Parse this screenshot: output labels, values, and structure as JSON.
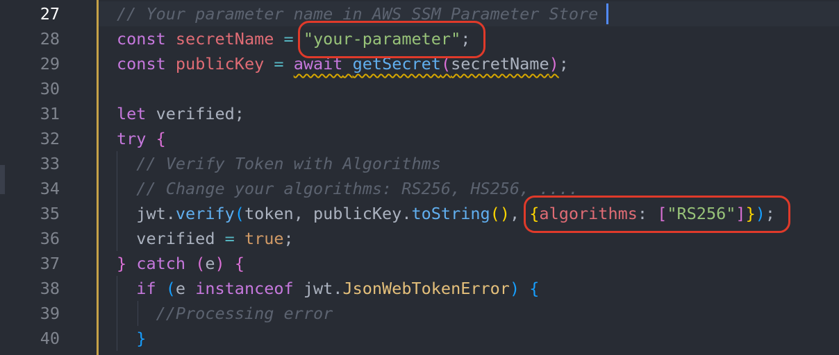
{
  "editor": {
    "current_line": 27,
    "lines": [
      {
        "number": "27",
        "tokens": [
          {
            "t": "// Your parameter name in AWS SSM Parameter Store",
            "c": "cmt"
          }
        ]
      },
      {
        "number": "28",
        "tokens": [
          {
            "t": "const",
            "c": "kw"
          },
          {
            "t": " ",
            "c": "plain"
          },
          {
            "t": "secretName",
            "c": "var"
          },
          {
            "t": " ",
            "c": "plain"
          },
          {
            "t": "=",
            "c": "op"
          },
          {
            "t": " ",
            "c": "plain"
          },
          {
            "t": "\"your-parameter\"",
            "c": "str"
          },
          {
            "t": ";",
            "c": "plain"
          }
        ]
      },
      {
        "number": "29",
        "tokens": [
          {
            "t": "const",
            "c": "kw"
          },
          {
            "t": " ",
            "c": "plain"
          },
          {
            "t": "publicKey",
            "c": "var"
          },
          {
            "t": " ",
            "c": "plain"
          },
          {
            "t": "=",
            "c": "op"
          },
          {
            "t": " ",
            "c": "plain"
          },
          {
            "t": "await",
            "c": "kw squiggle"
          },
          {
            "t": " ",
            "c": "plain squiggle"
          },
          {
            "t": "getSecret",
            "c": "fn squiggle"
          },
          {
            "t": "(",
            "c": "b2 squiggle"
          },
          {
            "t": "secretName",
            "c": "plain squiggle"
          },
          {
            "t": ")",
            "c": "b2 squiggle"
          },
          {
            "t": ";",
            "c": "plain"
          }
        ]
      },
      {
        "number": "30",
        "tokens": []
      },
      {
        "number": "31",
        "tokens": [
          {
            "t": "let",
            "c": "kw"
          },
          {
            "t": " verified;",
            "c": "plain"
          }
        ]
      },
      {
        "number": "32",
        "tokens": [
          {
            "t": "try",
            "c": "kw-ctrl"
          },
          {
            "t": " ",
            "c": "plain"
          },
          {
            "t": "{",
            "c": "b2"
          }
        ]
      },
      {
        "number": "33",
        "tokens": [
          {
            "t": "  ",
            "c": "plain"
          },
          {
            "t": "// Verify Token with Algorithms",
            "c": "cmt"
          }
        ]
      },
      {
        "number": "34",
        "tokens": [
          {
            "t": "  ",
            "c": "plain"
          },
          {
            "t": "// Change your algorithms: RS256, HS256, ....",
            "c": "cmt"
          }
        ]
      },
      {
        "number": "35",
        "tokens": [
          {
            "t": "  ",
            "c": "plain"
          },
          {
            "t": "jwt",
            "c": "plain"
          },
          {
            "t": ".",
            "c": "plain"
          },
          {
            "t": "verify",
            "c": "fn"
          },
          {
            "t": "(",
            "c": "b3"
          },
          {
            "t": "token, publicKey",
            "c": "plain"
          },
          {
            "t": ".",
            "c": "plain"
          },
          {
            "t": "toString",
            "c": "fn"
          },
          {
            "t": "()",
            "c": "b1"
          },
          {
            "t": ", ",
            "c": "plain"
          },
          {
            "t": "{",
            "c": "b1"
          },
          {
            "t": "algorithms",
            "c": "prop"
          },
          {
            "t": ": ",
            "c": "plain"
          },
          {
            "t": "[",
            "c": "b2"
          },
          {
            "t": "\"RS256\"",
            "c": "str"
          },
          {
            "t": "]",
            "c": "b2"
          },
          {
            "t": "}",
            "c": "b1"
          },
          {
            "t": ")",
            "c": "b3"
          },
          {
            "t": ";",
            "c": "plain"
          }
        ]
      },
      {
        "number": "36",
        "tokens": [
          {
            "t": "  ",
            "c": "plain"
          },
          {
            "t": "verified",
            "c": "plain"
          },
          {
            "t": " ",
            "c": "plain"
          },
          {
            "t": "=",
            "c": "op"
          },
          {
            "t": " ",
            "c": "plain"
          },
          {
            "t": "true",
            "c": "bool"
          },
          {
            "t": ";",
            "c": "plain"
          }
        ]
      },
      {
        "number": "37",
        "tokens": [
          {
            "t": "}",
            "c": "b2"
          },
          {
            "t": " ",
            "c": "plain"
          },
          {
            "t": "catch",
            "c": "kw-ctrl"
          },
          {
            "t": " ",
            "c": "plain"
          },
          {
            "t": "(",
            "c": "b2"
          },
          {
            "t": "e",
            "c": "plain"
          },
          {
            "t": ")",
            "c": "b2"
          },
          {
            "t": " ",
            "c": "plain"
          },
          {
            "t": "{",
            "c": "b2"
          }
        ]
      },
      {
        "number": "38",
        "tokens": [
          {
            "t": "  ",
            "c": "plain"
          },
          {
            "t": "if",
            "c": "kw-ctrl"
          },
          {
            "t": " ",
            "c": "plain"
          },
          {
            "t": "(",
            "c": "b3"
          },
          {
            "t": "e ",
            "c": "plain"
          },
          {
            "t": "instanceof",
            "c": "kw"
          },
          {
            "t": " jwt.",
            "c": "plain"
          },
          {
            "t": "JsonWebTokenError",
            "c": "cls"
          },
          {
            "t": ")",
            "c": "b3"
          },
          {
            "t": " ",
            "c": "plain"
          },
          {
            "t": "{",
            "c": "b3"
          }
        ]
      },
      {
        "number": "39",
        "tokens": [
          {
            "t": "    ",
            "c": "plain"
          },
          {
            "t": "//Processing error",
            "c": "cmt"
          }
        ]
      },
      {
        "number": "40",
        "tokens": [
          {
            "t": "  ",
            "c": "plain"
          },
          {
            "t": "}",
            "c": "b3"
          }
        ]
      }
    ]
  },
  "colors": {
    "background": "#282c34",
    "highlight_box": "#e03a2a",
    "modified_bar": "#c6a247",
    "cursor": "#528bff"
  },
  "annotations": [
    {
      "label": "secret-name-highlight",
      "line": "28",
      "text": "\"your-parameter\";"
    },
    {
      "label": "algorithms-highlight",
      "line": "35",
      "text": "{algorithms: [\"RS256\"]});"
    }
  ]
}
